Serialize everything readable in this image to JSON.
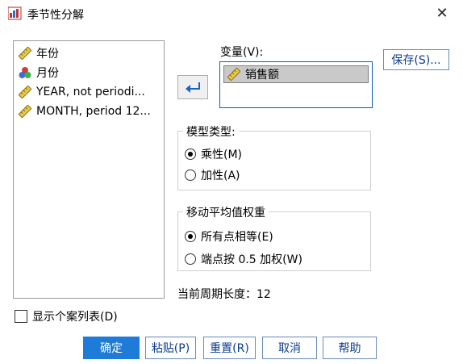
{
  "window": {
    "title": "季节性分解",
    "close_glyph": "✕"
  },
  "variables": [
    {
      "label": "年份",
      "icon": "scale-ruler-icon"
    },
    {
      "label": "月份",
      "icon": "nominal-balls-icon"
    },
    {
      "label": "YEAR, not periodi...",
      "icon": "scale-ruler-icon"
    },
    {
      "label": "MONTH, period 12...",
      "icon": "scale-ruler-icon"
    }
  ],
  "target": {
    "label": "变量(V):",
    "selected": "销售额"
  },
  "save_button": "保存(S)...",
  "model_type": {
    "title": "模型类型:",
    "options": [
      {
        "label": "乘性(M)",
        "selected": true
      },
      {
        "label": "加性(A)",
        "selected": false
      }
    ]
  },
  "moving_average": {
    "title": "移动平均值权重",
    "options": [
      {
        "label": "所有点相等(E)",
        "selected": true
      },
      {
        "label": "端点按 0.5 加权(W)",
        "selected": false
      }
    ]
  },
  "period_length": "当前周期长度：12",
  "show_casewise": {
    "label": "显示个案列表(D)",
    "checked": false
  },
  "buttons": {
    "ok": "确定",
    "paste": "粘贴(P)",
    "reset": "重置(R)",
    "cancel": "取消",
    "help": "帮助"
  },
  "colors": {
    "accent": "#1e7bd7",
    "link_text": "#0b3d8c",
    "target_border": "#0a5fb4"
  }
}
